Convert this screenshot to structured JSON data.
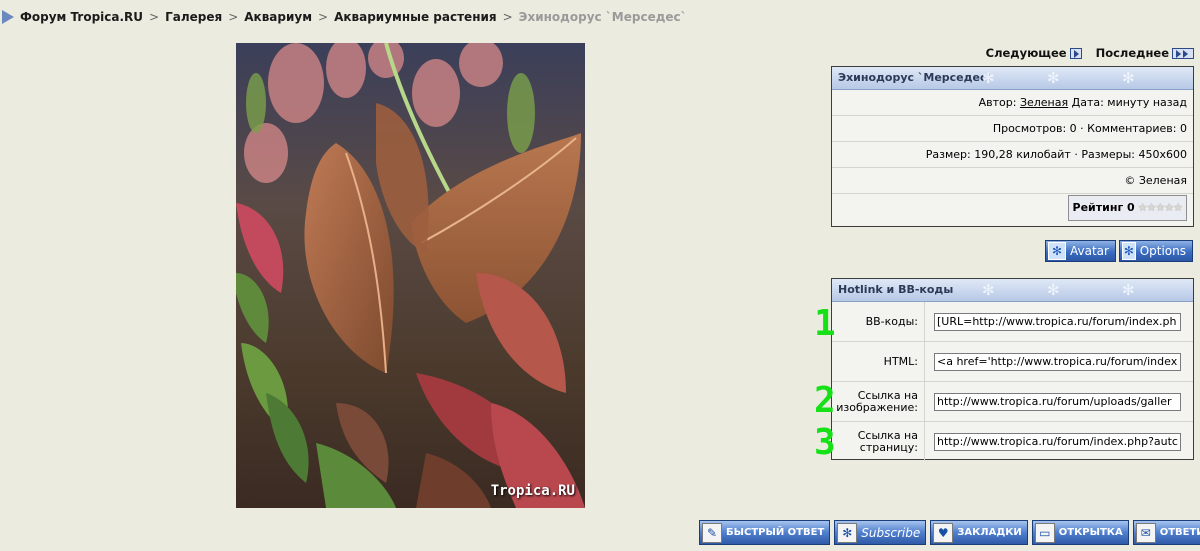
{
  "breadcrumb": {
    "items": [
      "Форум Tropica.RU",
      "Галерея",
      "Аквариум",
      "Аквариумные растения"
    ],
    "current": "Эхинодорус `Мерседес`",
    "separator": ">"
  },
  "photo": {
    "watermark": "Tropica.RU"
  },
  "nav": {
    "next": "Следующее",
    "last": "Последнее"
  },
  "info": {
    "title": "Эхинодорус `Мерседес`",
    "author_label": "Автор:",
    "author_name": "Зеленая",
    "date_text": "Дата: минуту назад",
    "stats": "Просмотров: 0 · Комментариев: 0",
    "size": "Размер: 190,28 килобайт · Размеры: 450x600",
    "copyright": "© Зеленая",
    "rating_label": "Рейтинг 0",
    "rating_value": 0,
    "rating_max": 5
  },
  "skin_buttons": {
    "avatar": "Avatar",
    "options": "Options"
  },
  "hotlink": {
    "title": "Hotlink и BB-коды",
    "rows": [
      {
        "label": "BB-коды:",
        "value": "[URL=http://www.tropica.ru/forum/index.ph"
      },
      {
        "label": "HTML:",
        "value": "<a href='http://www.tropica.ru/forum/index"
      },
      {
        "label": "Ссылка на изображение:",
        "value": "http://www.tropica.ru/forum/uploads/galler"
      },
      {
        "label": "Ссылка на страницу:",
        "value": "http://www.tropica.ru/forum/index.php?autc"
      }
    ]
  },
  "annotations": [
    "1",
    "2",
    "3"
  ],
  "toolbar": {
    "quick_reply": "БЫСТРЫЙ ОТВЕТ",
    "subscribe": "Subscribe",
    "bookmarks": "ЗАКЛАДКИ",
    "postcard": "ОТКРЫТКА",
    "reply": "ОТВЕТИТЬ"
  },
  "colors": {
    "background": "#ecebe0",
    "panel_header": "#b7c9e6",
    "button_blue": "#3a6cc1",
    "annotation_green": "#16e116"
  }
}
